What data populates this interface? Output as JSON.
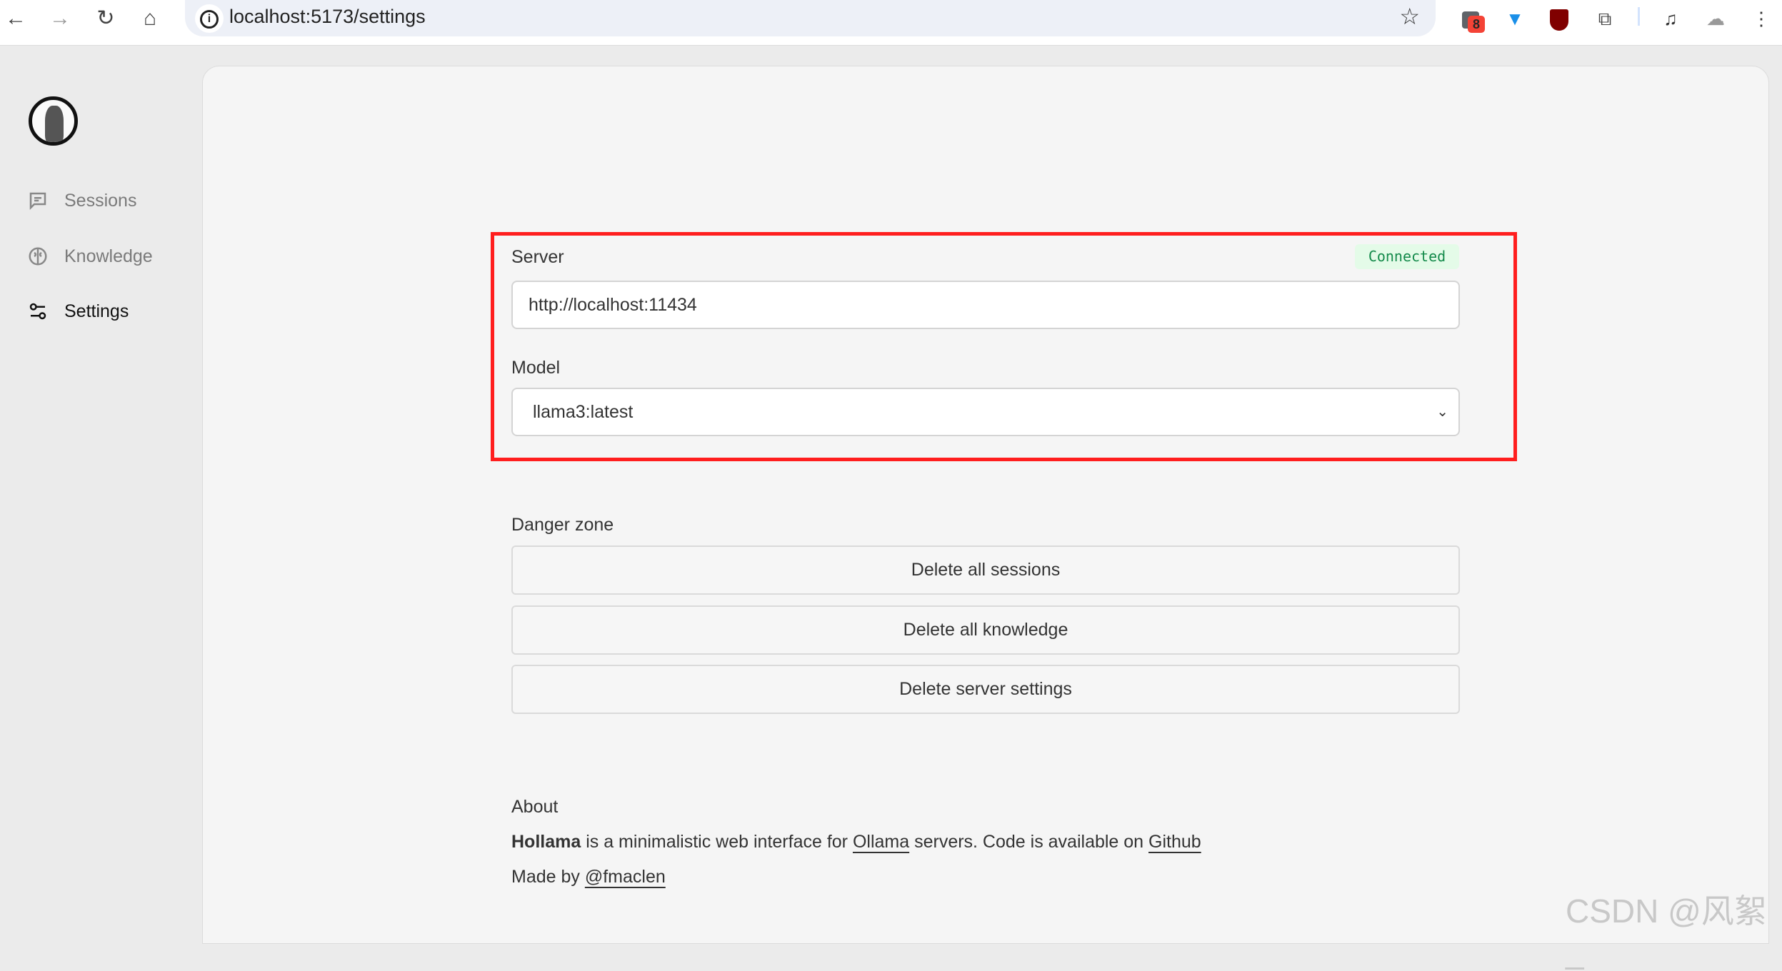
{
  "browser": {
    "url": "localhost:5173/settings",
    "extension_badge": "8",
    "icons": [
      "back-icon",
      "forward-icon",
      "reload-icon",
      "home-icon",
      "info-icon",
      "star-icon",
      "extension-icon",
      "filter-icon",
      "ublock-icon",
      "puzzle-icon",
      "media-icon",
      "cat-icon",
      "menu-icon"
    ]
  },
  "sidebar": {
    "items": [
      {
        "label": "Sessions",
        "icon": "chat-icon"
      },
      {
        "label": "Knowledge",
        "icon": "brain-icon"
      },
      {
        "label": "Settings",
        "icon": "sliders-icon",
        "active": true
      }
    ]
  },
  "server": {
    "label": "Server",
    "status": "Connected",
    "url_value": "http://localhost:11434"
  },
  "model": {
    "label": "Model",
    "selected": "llama3:latest"
  },
  "danger": {
    "label": "Danger zone",
    "buttons": [
      "Delete all sessions",
      "Delete all knowledge",
      "Delete server settings"
    ]
  },
  "about": {
    "title": "About",
    "app_name": "Hollama",
    "text1": " is a minimalistic web interface for ",
    "link_ollama": "Ollama",
    "text2": " servers. Code is available on ",
    "link_github": "Github",
    "made_by": "Made by ",
    "link_author": "@fmaclen"
  },
  "watermark": "CSDN @风絮_",
  "colors": {
    "highlight": "#ff1e1e",
    "connected": "#138a4a",
    "connected_bg": "#e4fbe8"
  }
}
